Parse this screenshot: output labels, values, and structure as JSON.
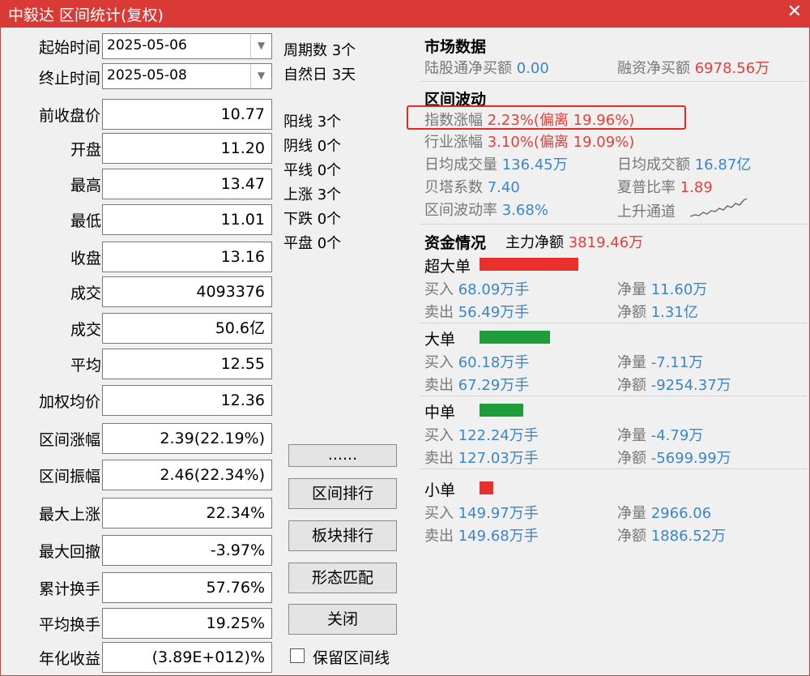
{
  "window": {
    "title": "中毅达 区间统计(复权)",
    "close_icon": "close-icon"
  },
  "form": {
    "start_label": "起始时间",
    "start_value": "2025-05-06",
    "end_label": "终止时间",
    "end_value": "2025-05-08",
    "rows": [
      {
        "label": "前收盘价",
        "value": "10.77"
      },
      {
        "label": "开盘价",
        "value": "11.20"
      },
      {
        "label": "最高价",
        "value": "13.47"
      },
      {
        "label": "最低价",
        "value": "11.01"
      },
      {
        "label": "收盘价",
        "value": "13.16"
      },
      {
        "label": "成交量",
        "value": "4093376"
      },
      {
        "label": "成交额",
        "value": "50.6亿"
      },
      {
        "label": "平均价",
        "value": "12.55"
      },
      {
        "label": "加权均价",
        "value": "12.36"
      },
      {
        "label": "区间涨幅",
        "value": "2.39(22.19%)"
      },
      {
        "label": "区间振幅",
        "value": "2.46(22.34%)"
      },
      {
        "label": "最大上涨",
        "value": "22.34%"
      },
      {
        "label": "最大回撤",
        "value": "-3.97%"
      },
      {
        "label": "累计换手",
        "value": "57.76%"
      },
      {
        "label": "平均换手",
        "value": "19.25%"
      },
      {
        "label": "年化收益",
        "value": "(3.89E+012)%"
      }
    ]
  },
  "period": {
    "cycles": "周期数 3个",
    "natural_days": "自然日 3天",
    "counts": [
      "阳线 3个",
      "阴线 0个",
      "平线 0个",
      "上涨 3个",
      "下跌 0个",
      "平盘 0个"
    ]
  },
  "buttons": {
    "more": "......",
    "range_rank": "区间排行",
    "sector_rank": "板块排行",
    "pattern_match": "形态匹配",
    "close": "关闭",
    "keep_range_line": "保留区间线"
  },
  "market": {
    "header": "市场数据",
    "northbound_label": "陆股通净买额",
    "northbound_value": "0.00",
    "margin_label": "融资净买额",
    "margin_value": "6978.56万"
  },
  "volatility": {
    "header": "区间波动",
    "index_change_label": "指数涨幅",
    "index_change_value": "2.23%(偏离 19.96%)",
    "industry_change_label": "行业涨幅",
    "industry_change_value": "3.10%(偏离 19.09%)",
    "avg_volume_label": "日均成交量",
    "avg_volume_value": "136.45万",
    "avg_turnover_label": "日均成交额",
    "avg_turnover_value": "16.87亿",
    "beta_label": "贝塔系数",
    "beta_value": "7.40",
    "sharpe_label": "夏普比率",
    "sharpe_value": "1.89",
    "vol_rate_label": "区间波动率",
    "vol_rate_value": "3.68%",
    "channel_label": "上升通道",
    "trend_icon": "uptrend-sparkline-icon"
  },
  "funds": {
    "header": "资金情况",
    "main_net_label": "主力净额",
    "main_net_value": "3819.46万",
    "colors": {
      "inflow": "#e8312d",
      "outflow": "#1f9d3d"
    },
    "groups": [
      {
        "name": "超大单",
        "bar_color": "#e8312d",
        "bar_ratio": 1.0,
        "buy_label": "买入",
        "buy": "68.09万手",
        "sell_label": "卖出",
        "sell": "56.49万手",
        "net_qty_label": "净量",
        "net_qty": "11.60万",
        "net_amt_label": "净额",
        "net_amt": "1.31亿"
      },
      {
        "name": "大单",
        "bar_color": "#1f9d3d",
        "bar_ratio": 0.71,
        "buy_label": "买入",
        "buy": "60.18万手",
        "sell_label": "卖出",
        "sell": "67.29万手",
        "net_qty_label": "净量",
        "net_qty": "-7.11万",
        "net_amt_label": "净额",
        "net_amt": "-9254.37万"
      },
      {
        "name": "中单",
        "bar_color": "#1f9d3d",
        "bar_ratio": 0.44,
        "buy_label": "买入",
        "buy": "122.24万手",
        "sell_label": "卖出",
        "sell": "127.03万手",
        "net_qty_label": "净量",
        "net_qty": "-4.79万",
        "net_amt_label": "净额",
        "net_amt": "-5699.99万"
      },
      {
        "name": "小单",
        "bar_color": "#e8312d",
        "bar_ratio": 0.14,
        "buy_label": "买入",
        "buy": "149.97万手",
        "sell_label": "卖出",
        "sell": "149.68万手",
        "net_qty_label": "净量",
        "net_qty": "2966.06",
        "net_amt_label": "净额",
        "net_amt": "1886.52万"
      }
    ]
  }
}
